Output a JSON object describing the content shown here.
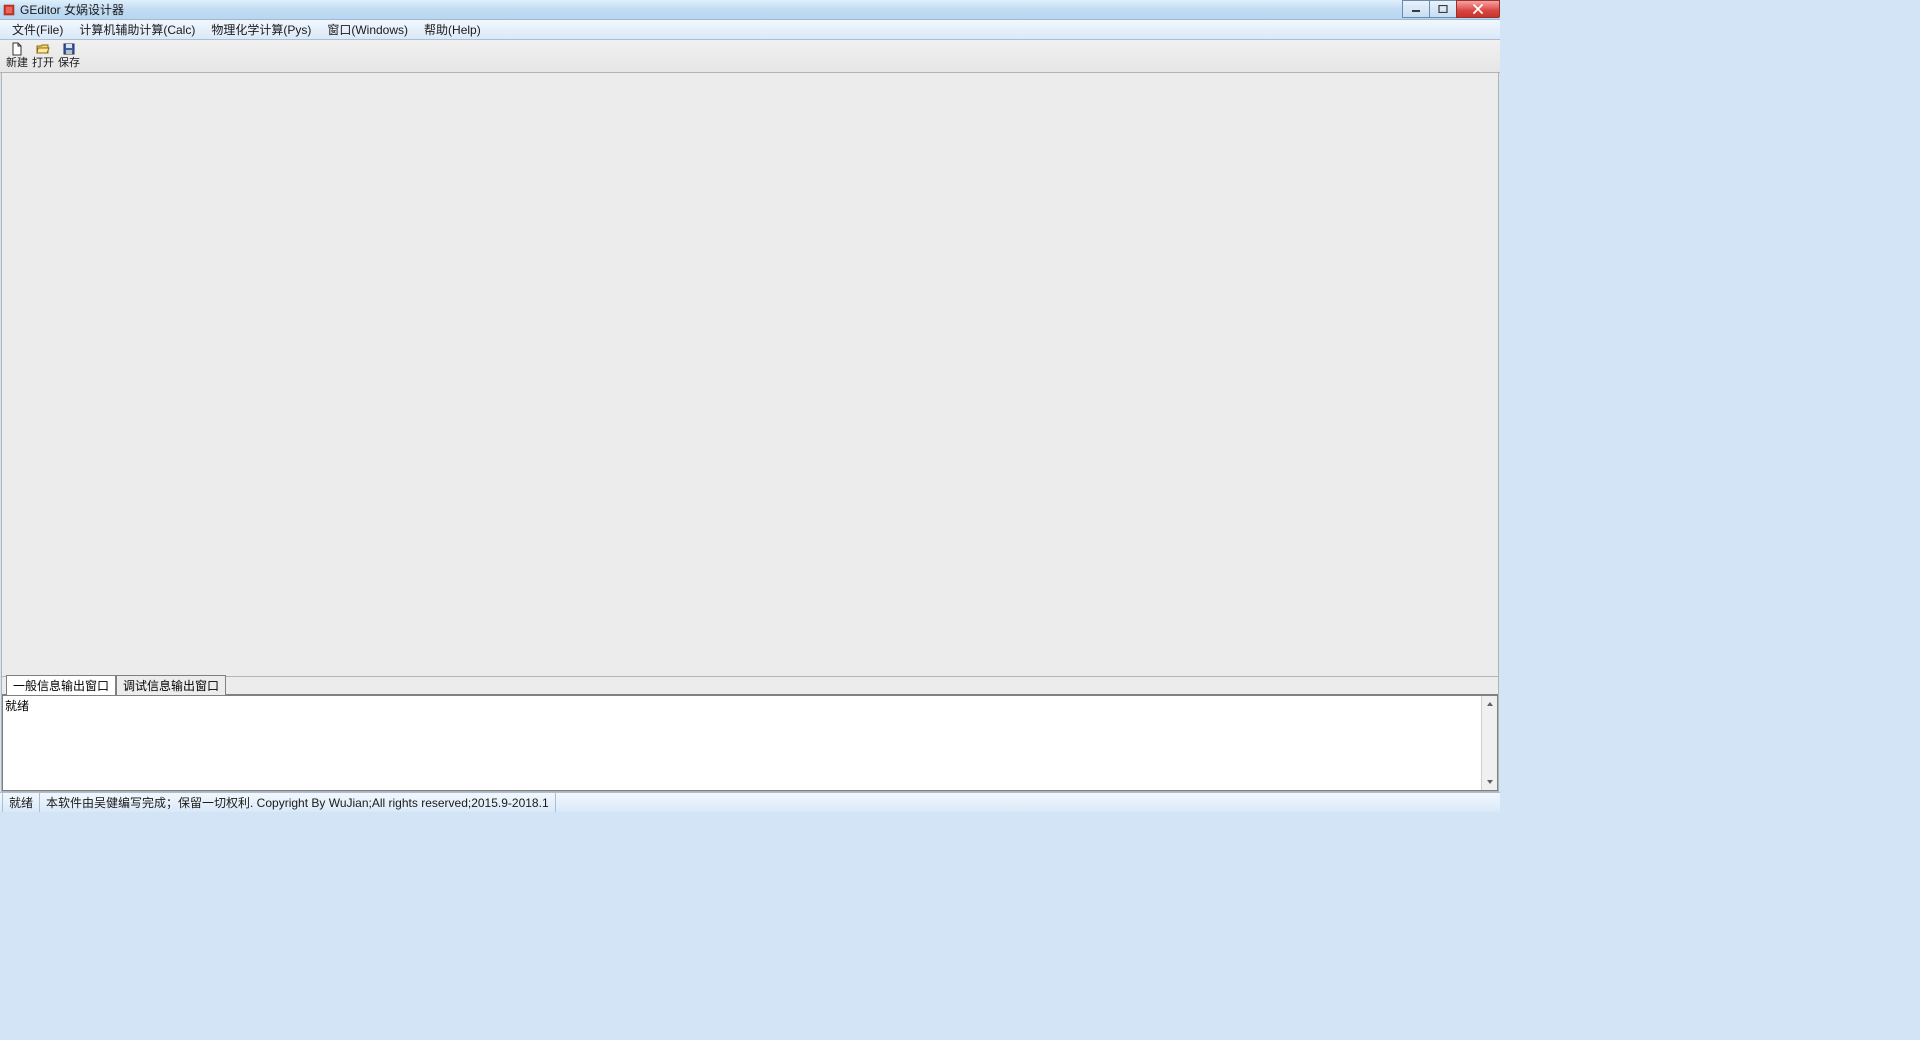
{
  "window": {
    "title": "GEditor 女娲设计器"
  },
  "menubar": {
    "items": [
      {
        "label": "文件(File)"
      },
      {
        "label": "计算机辅助计算(Calc)"
      },
      {
        "label": "物理化学计算(Pys)"
      },
      {
        "label": "窗口(Windows)"
      },
      {
        "label": "帮助(Help)"
      }
    ]
  },
  "toolbar": {
    "new_label": "新建",
    "open_label": "打开",
    "save_label": "保存"
  },
  "output": {
    "tabs": [
      {
        "label": "一般信息输出窗口",
        "active": true
      },
      {
        "label": "调试信息输出窗口",
        "active": false
      }
    ],
    "text": "就绪"
  },
  "statusbar": {
    "ready": "就绪",
    "copyright": "本软件由吴健编写完成；保留一切权利. Copyright By WuJian;All rights reserved;2015.9-2018.1"
  }
}
